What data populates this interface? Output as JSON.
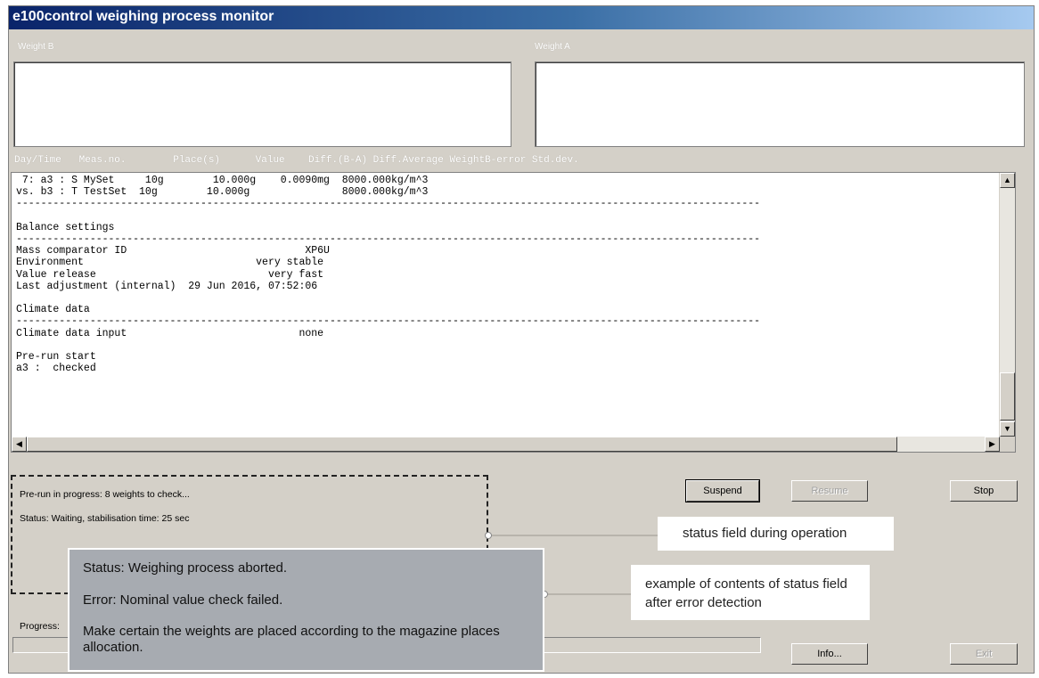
{
  "window": {
    "title": "e100control weighing process monitor"
  },
  "groups": {
    "weight_b": "Weight B",
    "weight_a": "Weight A"
  },
  "log": {
    "column_header": "Day/Time   Meas.no.        Place(s)      Value    Diff.(B-A) Diff.Average WeightB-error Std.dev.",
    "lines": [
      " 7: a3 : S MySet     10g        10.000g    0.0090mg  8000.000kg/m^3",
      "vs. b3 : T TestSet  10g        10.000g               8000.000kg/m^3",
      "-------------------------------------------------------------------------------------------------------------------------",
      "",
      "Balance settings",
      "-------------------------------------------------------------------------------------------------------------------------",
      "Mass comparator ID                             XP6U",
      "Environment                            very stable",
      "Value release                            very fast",
      "Last adjustment (internal)  29 Jun 2016, 07:52:06",
      "",
      "Climate data",
      "-------------------------------------------------------------------------------------------------------------------------",
      "Climate data input                            none",
      "",
      "Pre-run start",
      "a3 :  checked"
    ]
  },
  "status": {
    "prerun": "Pre-run in progress: 8 weights to check...",
    "status_line": "Status: Waiting, stabilisation time: 25 sec"
  },
  "buttons": {
    "suspend": "Suspend",
    "resume": "Resume",
    "stop": "Stop",
    "info": "Info...",
    "exit": "Exit"
  },
  "progress": {
    "label": "Progress:",
    "value": 0
  },
  "error_panel": {
    "line1": "Status: Weighing process aborted.",
    "line2": "Error: Nominal value check failed.",
    "line3": "Make certain the weights are placed according to the magazine places allocation."
  },
  "callouts": {
    "status_field": "status field during operation",
    "error_example": "example of contents of status field after error detection"
  }
}
